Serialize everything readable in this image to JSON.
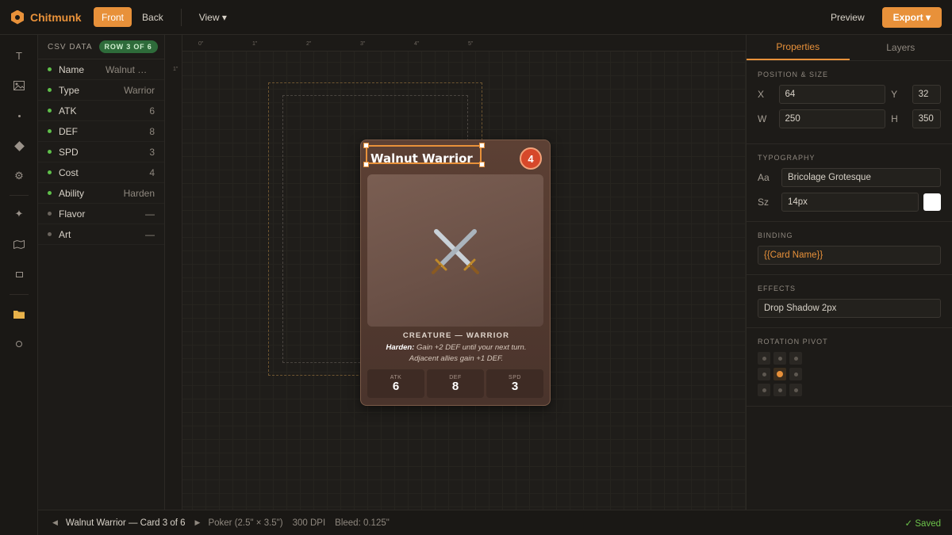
{
  "app": {
    "name": "Chitmunk"
  },
  "topbar": {
    "front_label": "Front",
    "back_label": "Back",
    "view_label": "View ▾",
    "preview_label": "Preview",
    "export_label": "Export ▾",
    "accent": "#e8913a"
  },
  "tools": [
    "text-tool-icon",
    "image-tool-icon",
    "dot-tool-icon",
    "shape-tool-icon",
    "settings-tool-icon",
    "sparkle-tool-icon",
    "map-tool-icon",
    "frame-tool-icon",
    "folder-tool-icon",
    "circle-tool-icon"
  ],
  "data_panel": {
    "title": "CSV DATA",
    "row_badge": "ROW 3 OF 6",
    "fields": [
      {
        "key": "Name",
        "value": "Walnut Warrior",
        "bound": true
      },
      {
        "key": "Type",
        "value": "Warrior",
        "bound": true
      },
      {
        "key": "ATK",
        "value": "6",
        "bound": true
      },
      {
        "key": "DEF",
        "value": "8",
        "bound": true
      },
      {
        "key": "SPD",
        "value": "3",
        "bound": true
      },
      {
        "key": "Cost",
        "value": "4",
        "bound": true
      },
      {
        "key": "Ability",
        "value": "Harden",
        "bound": true
      },
      {
        "key": "Flavor",
        "value": "—",
        "bound": false
      },
      {
        "key": "Art",
        "value": "—",
        "bound": false
      }
    ]
  },
  "ruler": {
    "ticks": [
      "0\"",
      "1\"",
      "2\"",
      "3\"",
      "4\"",
      "5\""
    ],
    "left_tick": "1\""
  },
  "card": {
    "name": "Walnut Warrior",
    "cost": "4",
    "art_icon": "⚔️",
    "type_line": "CREATURE — WARRIOR",
    "ability_name": "Harden:",
    "ability_text": "Gain +2 DEF until your next turn. Adjacent allies gain +1 DEF.",
    "stats": [
      {
        "label": "ATK",
        "value": "6"
      },
      {
        "label": "DEF",
        "value": "8"
      },
      {
        "label": "SPD",
        "value": "3"
      }
    ]
  },
  "properties": {
    "tabs": [
      "Properties",
      "Layers"
    ],
    "position_title": "POSITION & SIZE",
    "x_label": "X",
    "x": "64",
    "y_label": "Y",
    "y": "32",
    "w_label": "W",
    "w": "250",
    "h_label": "H",
    "h": "350",
    "typography_title": "TYPOGRAPHY",
    "font_label": "Aa",
    "font": "Bricolage Grotesque",
    "size_label": "Sz",
    "size": "14px",
    "text_color": "#ffffff",
    "binding_title": "BINDING",
    "binding": "{{Card Name}}",
    "effects_title": "EFFECTS",
    "effect": "Drop Shadow 2px",
    "pivot_title": "ROTATION PIVOT",
    "pivot_selected": 4
  },
  "status": {
    "card_label": "Walnut Warrior — Card 3 of 6",
    "format": "Poker (2.5\" × 3.5\")",
    "dpi": "300 DPI",
    "bleed": "Bleed: 0.125\"",
    "saved": "✓ Saved"
  }
}
